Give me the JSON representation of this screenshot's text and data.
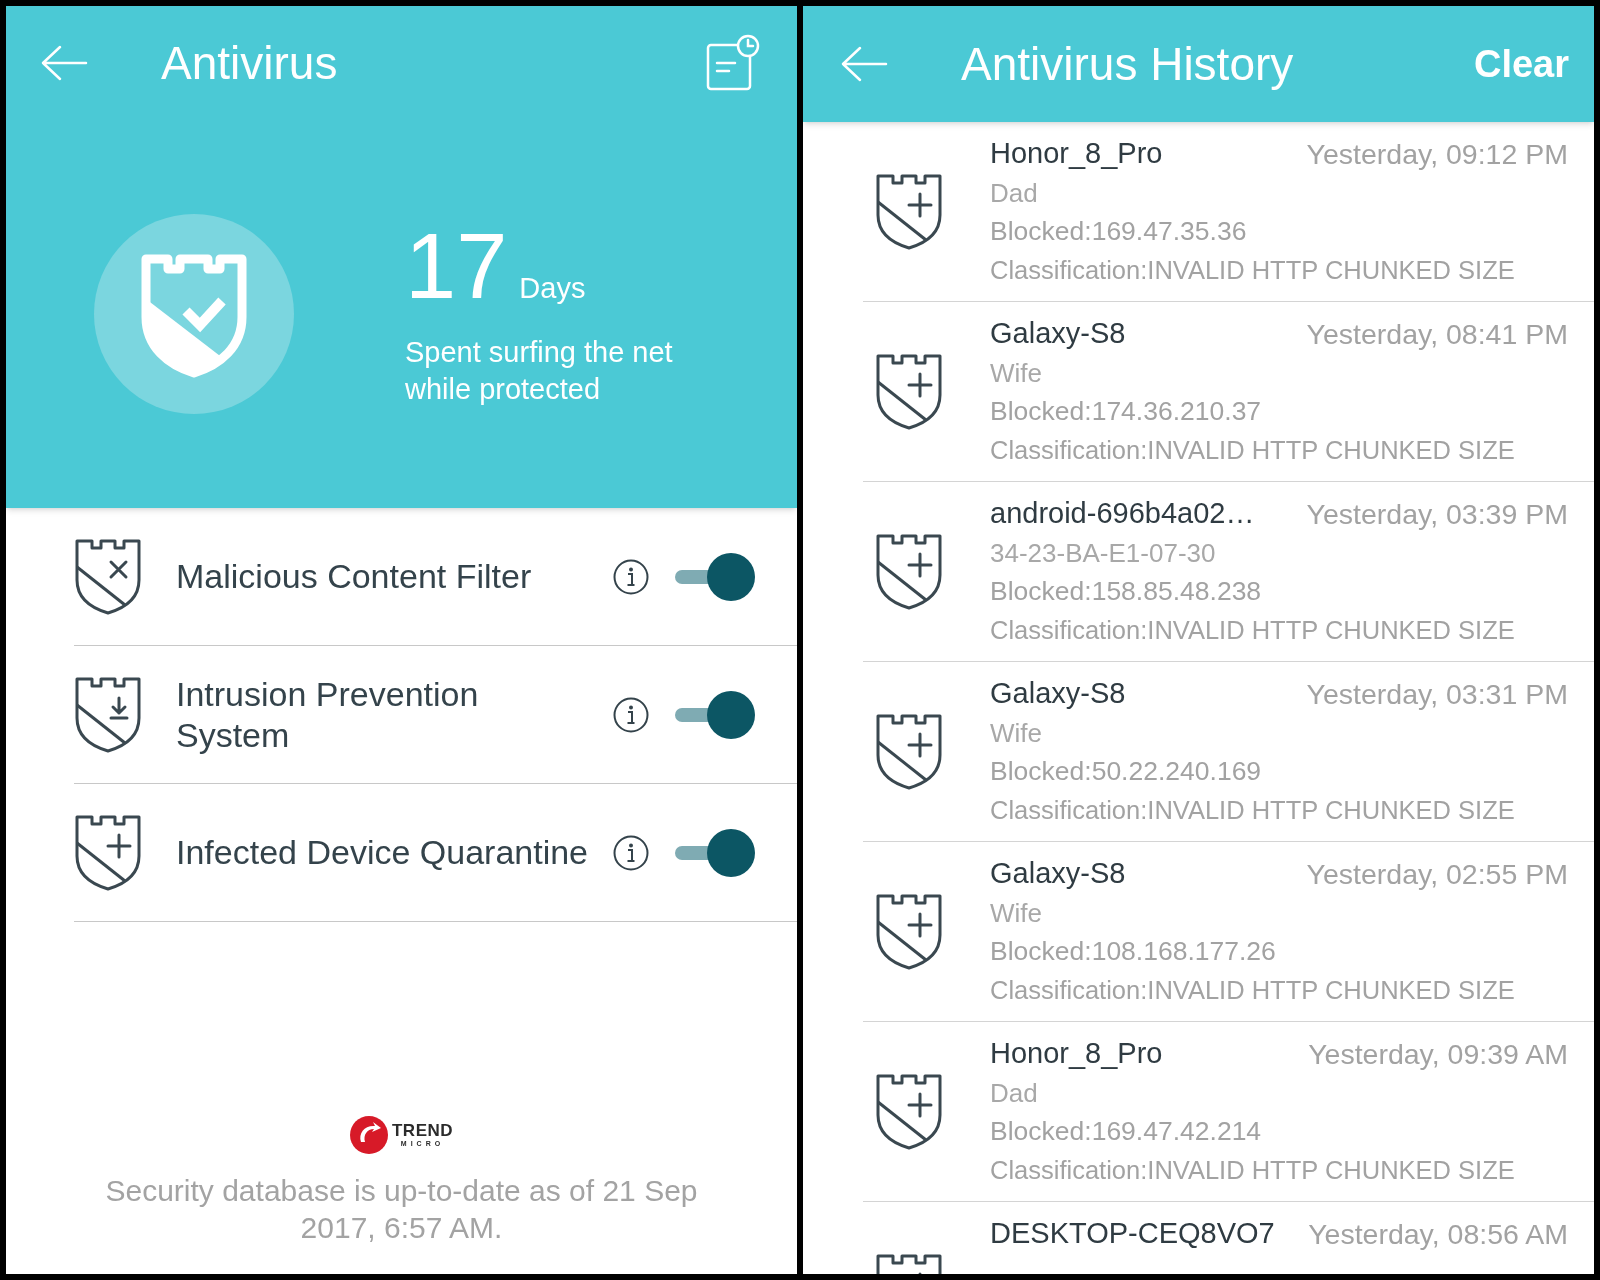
{
  "antivirus": {
    "title": "Antivirus",
    "hero": {
      "count": "17",
      "unit": "Days",
      "caption": "Spent surfing the net while protected"
    },
    "features": [
      {
        "label": "Malicious Content Filter",
        "on": true
      },
      {
        "label": "Intrusion Prevention System",
        "on": true
      },
      {
        "label": "Infected Device Quarantine",
        "on": true
      }
    ],
    "logo": {
      "wordmark": "TREND",
      "subtitle": "MICRO"
    },
    "footer": "Security database is up-to-date as of 21 Sep 2017, 6:57 AM."
  },
  "history": {
    "title": "Antivirus History",
    "action": "Clear",
    "entries": [
      {
        "device": "Honor_8_Pro",
        "time": "Yesterday, 09:12 PM",
        "owner": "Dad",
        "blocked": "Blocked:169.47.35.36",
        "classification": "Classification:INVALID HTTP CHUNKED SIZE"
      },
      {
        "device": "Galaxy-S8",
        "time": "Yesterday, 08:41 PM",
        "owner": "Wife",
        "blocked": "Blocked:174.36.210.37",
        "classification": "Classification:INVALID HTTP CHUNKED SIZE"
      },
      {
        "device": "android-696b4a02…",
        "time": "Yesterday, 03:39 PM",
        "owner": "34-23-BA-E1-07-30",
        "blocked": "Blocked:158.85.48.238",
        "classification": "Classification:INVALID HTTP CHUNKED SIZE"
      },
      {
        "device": "Galaxy-S8",
        "time": "Yesterday, 03:31 PM",
        "owner": "Wife",
        "blocked": "Blocked:50.22.240.169",
        "classification": "Classification:INVALID HTTP CHUNKED SIZE"
      },
      {
        "device": "Galaxy-S8",
        "time": "Yesterday, 02:55 PM",
        "owner": "Wife",
        "blocked": "Blocked:108.168.177.26",
        "classification": "Classification:INVALID HTTP CHUNKED SIZE"
      },
      {
        "device": "Honor_8_Pro",
        "time": "Yesterday, 09:39 AM",
        "owner": "Dad",
        "blocked": "Blocked:169.47.42.214",
        "classification": "Classification:INVALID HTTP CHUNKED SIZE"
      },
      {
        "device": "DESKTOP-CEQ8VO7",
        "time": "Yesterday, 08:56 AM"
      }
    ]
  }
}
